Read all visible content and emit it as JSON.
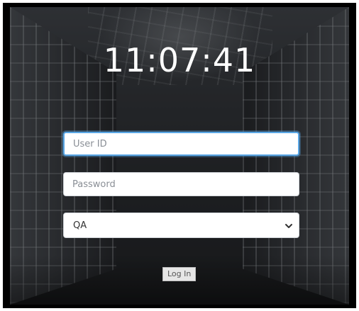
{
  "clock": {
    "time": "11:07:41"
  },
  "login_form": {
    "user_id": {
      "placeholder": "User ID",
      "value": ""
    },
    "password": {
      "placeholder": "Password",
      "value": ""
    },
    "environment": {
      "selected": "QA",
      "options": [
        "QA"
      ]
    },
    "login_label": "Log In"
  },
  "theme": {
    "focus_border": "#5aa7e6",
    "text_color": "#ffffff"
  }
}
